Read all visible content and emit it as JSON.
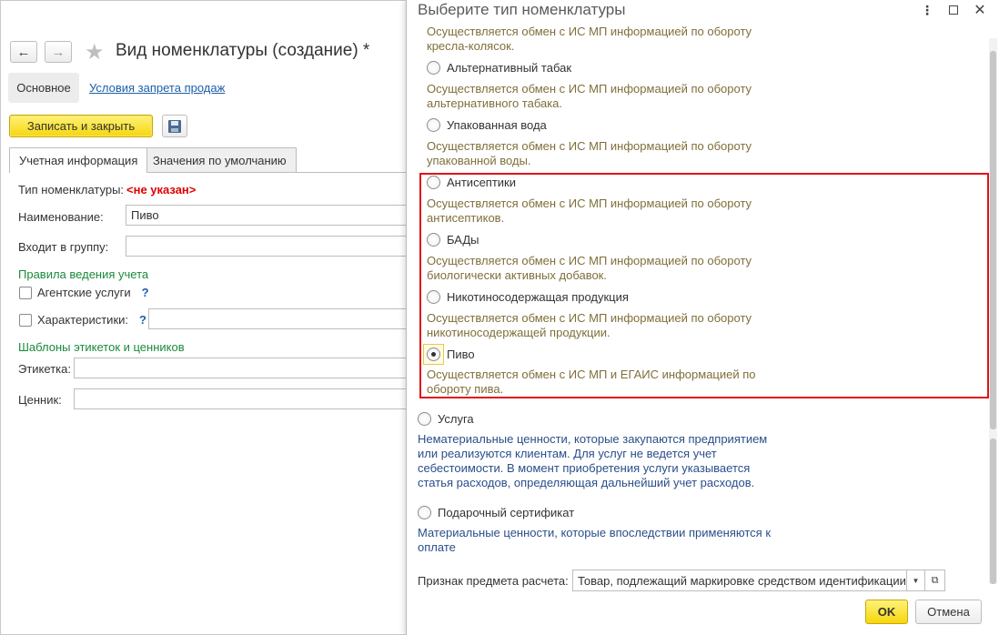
{
  "form": {
    "title": "Вид номенклатуры  (создание) *",
    "back_icon": "←",
    "forward_icon": "→",
    "favorite_icon": "★",
    "section_main": "Основное",
    "section_link": "Условия запрета продаж",
    "save_close": "Записать и закрыть",
    "tabs": [
      "Учетная информация",
      "Значения по умолчанию"
    ],
    "type_label": "Тип номенклатуры:",
    "type_value": "<не указан>",
    "name_label": "Наименование:",
    "name_value": "Пиво",
    "group_label": "Входит в группу:",
    "rules_header": "Правила ведения учета",
    "agent_label": "Агентские услуги",
    "chars_label": "Характеристики:",
    "help": "?",
    "templates_header": "Шаблоны этикеток и ценников",
    "label_label": "Этикетка:",
    "price_label": "Ценник:"
  },
  "dialog": {
    "title": "Выберите тип номенклатуры",
    "more_icon": "⋮",
    "close_icon": "✕",
    "options": [
      {
        "title": "",
        "desc1": "Осуществляется обмен с ИС МП информацией по обороту",
        "desc2": "кресла-колясок.",
        "selected": false
      },
      {
        "title": "Альтернативный табак",
        "desc1": "Осуществляется обмен с ИС МП информацией по обороту",
        "desc2": "альтернативного табака.",
        "selected": false
      },
      {
        "title": "Упакованная вода",
        "desc1": "Осуществляется обмен с ИС МП информацией по обороту",
        "desc2": "упакованной воды.",
        "selected": false
      },
      {
        "title": "Антисептики",
        "desc1": "Осуществляется обмен с ИС МП информацией по обороту",
        "desc2": "антисептиков.",
        "selected": false
      },
      {
        "title": "БАДы",
        "desc1": "Осуществляется обмен с ИС МП информацией по обороту",
        "desc2": "биологически активных добавок.",
        "selected": false
      },
      {
        "title": "Никотиносодержащая продукция",
        "desc1": "Осуществляется обмен с ИС МП информацией по обороту",
        "desc2": "никотиносодержащей продукции.",
        "selected": false
      },
      {
        "title": "Пиво",
        "desc1": "Осуществляется обмен с ИС МП и ЕГАИС информацией по",
        "desc2": "обороту пива.",
        "selected": true
      }
    ],
    "service": {
      "title": "Услуга",
      "desc": [
        "Нематериальные ценности, которые закупаются предприятием",
        "или реализуются клиентам. Для услуг не ведется учет",
        "себестоимости. В момент приобретения услуги указывается",
        "статья расходов, определяющая дальнейший учет расходов."
      ]
    },
    "gift": {
      "title": "Подарочный сертификат",
      "desc": [
        "Материальные ценности, которые впоследствии применяются к",
        "оплате"
      ]
    },
    "attr_label": "Признак предмета расчета:",
    "attr_value": "Товар, подлежащий маркировке средством идентификации, ",
    "ok": "OK",
    "cancel": "Отмена"
  },
  "colors": {
    "accent_yellow": "#f5d60e",
    "error_red": "#e00000",
    "section_green": "#1a8a3a",
    "link_blue": "#1b5faa",
    "highlight_red": "#e0141a"
  }
}
